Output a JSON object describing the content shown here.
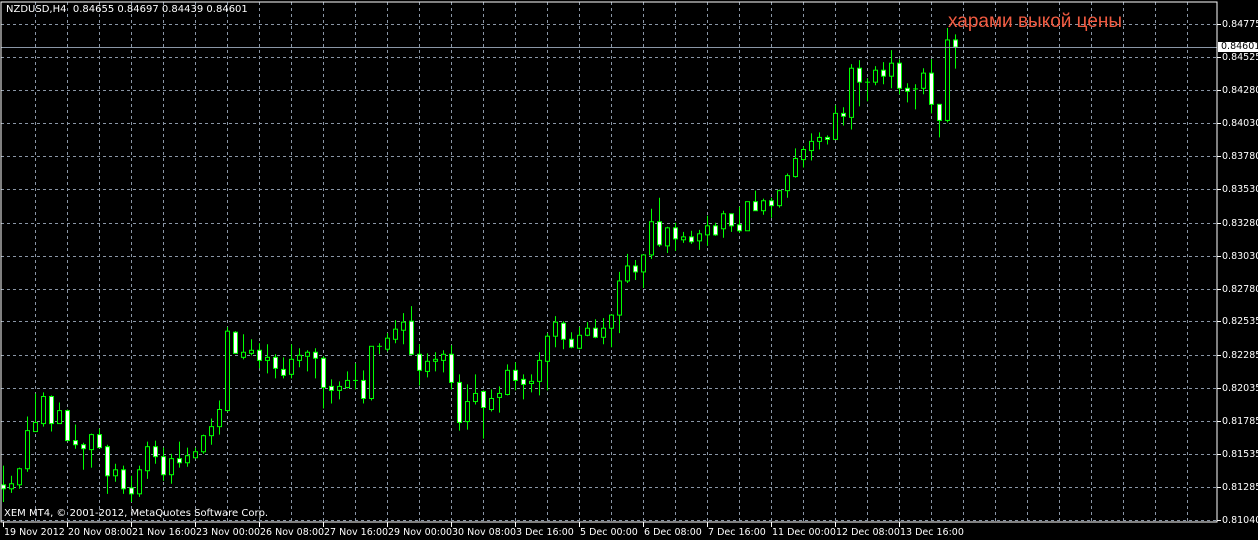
{
  "header": {
    "symbol": "NZDUSD,H4",
    "ohlc": "0.84655 0.84697 0.84439 0.84601"
  },
  "copyright": "XEM MT4, © 2001-2012, MetaQuotes Software Corp.",
  "annotation": "харами выкой цены",
  "current_price_label": "0.84601",
  "colors": {
    "background": "#000000",
    "candle_outline": "#00ff00",
    "bear_fill": "#ffffff",
    "bull_fill": "#000000",
    "grid": "#8a96a6",
    "annotation": "#f05a40"
  },
  "chart_data": {
    "type": "candlestick",
    "symbol": "NZDUSD",
    "timeframe": "H4",
    "ylim": [
      0.8104,
      0.84775
    ],
    "grid": true,
    "y_ticks": [
      "0.84775",
      "0.84525",
      "0.84280",
      "0.84030",
      "0.83780",
      "0.83530",
      "0.83280",
      "0.83030",
      "0.82780",
      "0.82535",
      "0.82285",
      "0.82035",
      "0.81785",
      "0.81535",
      "0.81285",
      "0.81040"
    ],
    "x_ticks": [
      "19 Nov 2012",
      "20 Nov 08:00",
      "21 Nov 16:00",
      "23 Nov 00:00",
      "26 Nov 08:00",
      "27 Nov 16:00",
      "29 Nov 00:00",
      "30 Nov 08:00",
      "3 Dec 16:00",
      "5 Dec 00:00",
      "6 Dec 08:00",
      "7 Dec 16:00",
      "11 Dec 00:00",
      "12 Dec 08:00",
      "13 Dec 16:00"
    ],
    "x_tick_every_n_bars": 8,
    "current_price": 0.84601,
    "ohlc": [
      [
        0.81305,
        0.81449,
        0.81176,
        0.81275
      ],
      [
        0.81275,
        0.81373,
        0.81244,
        0.81313
      ],
      [
        0.81305,
        0.81434,
        0.81275,
        0.81426
      ],
      [
        0.81426,
        0.81819,
        0.81403,
        0.81713
      ],
      [
        0.81706,
        0.81993,
        0.81706,
        0.81774
      ],
      [
        0.81766,
        0.82001,
        0.81743,
        0.8197
      ],
      [
        0.8197,
        0.81978,
        0.81706,
        0.81766
      ],
      [
        0.81766,
        0.81925,
        0.81766,
        0.81864
      ],
      [
        0.81864,
        0.81872,
        0.81638,
        0.81638
      ],
      [
        0.81638,
        0.81759,
        0.81577,
        0.81607
      ],
      [
        0.81607,
        0.81622,
        0.81418,
        0.81577
      ],
      [
        0.8157,
        0.8169,
        0.81434,
        0.81683
      ],
      [
        0.81683,
        0.81728,
        0.81585,
        0.81585
      ],
      [
        0.81592,
        0.81607,
        0.81237,
        0.81373
      ],
      [
        0.81373,
        0.81464,
        0.81328,
        0.81418
      ],
      [
        0.81418,
        0.81449,
        0.81237,
        0.81275
      ],
      [
        0.81282,
        0.81373,
        0.81176,
        0.81237
      ],
      [
        0.81237,
        0.81449,
        0.81214,
        0.81418
      ],
      [
        0.81411,
        0.8163,
        0.8135,
        0.81592
      ],
      [
        0.81592,
        0.81638,
        0.81464,
        0.81517
      ],
      [
        0.81517,
        0.81585,
        0.81335,
        0.81381
      ],
      [
        0.81381,
        0.81539,
        0.81313,
        0.81502
      ],
      [
        0.81502,
        0.8163,
        0.81434,
        0.81471
      ],
      [
        0.81471,
        0.81585,
        0.81441,
        0.81524
      ],
      [
        0.81509,
        0.81585,
        0.81502,
        0.81554
      ],
      [
        0.81554,
        0.81683,
        0.81539,
        0.81675
      ],
      [
        0.81675,
        0.81804,
        0.81607,
        0.81743
      ],
      [
        0.81743,
        0.8194,
        0.81683,
        0.81872
      ],
      [
        0.81864,
        0.82492,
        0.81857,
        0.82462
      ],
      [
        0.82454,
        0.82462,
        0.82295,
        0.82295
      ],
      [
        0.82265,
        0.82439,
        0.8225,
        0.82303
      ],
      [
        0.82295,
        0.82401,
        0.8228,
        0.82318
      ],
      [
        0.82318,
        0.82371,
        0.82182,
        0.82242
      ],
      [
        0.82242,
        0.82363,
        0.82144,
        0.82265
      ],
      [
        0.82265,
        0.82288,
        0.82106,
        0.82182
      ],
      [
        0.82174,
        0.82265,
        0.82106,
        0.82129
      ],
      [
        0.82137,
        0.82363,
        0.82106,
        0.8225
      ],
      [
        0.82242,
        0.82333,
        0.8219,
        0.8228
      ],
      [
        0.82273,
        0.82318,
        0.82159,
        0.82303
      ],
      [
        0.82303,
        0.82333,
        0.82106,
        0.82258
      ],
      [
        0.82258,
        0.82273,
        0.8188,
        0.82038
      ],
      [
        0.82046,
        0.82099,
        0.81917,
        0.82016
      ],
      [
        0.82016,
        0.82084,
        0.81948,
        0.82046
      ],
      [
        0.82038,
        0.82159,
        0.82031,
        0.82091
      ],
      [
        0.82091,
        0.8222,
        0.82023,
        0.82091
      ],
      [
        0.82091,
        0.82167,
        0.81917,
        0.81955
      ],
      [
        0.81955,
        0.82348,
        0.8194,
        0.82348
      ],
      [
        0.82341,
        0.82371,
        0.82288,
        0.82348
      ],
      [
        0.82326,
        0.82447,
        0.8231,
        0.82409
      ],
      [
        0.82401,
        0.82545,
        0.82371,
        0.82477
      ],
      [
        0.82469,
        0.82598,
        0.82363,
        0.8253
      ],
      [
        0.82537,
        0.82651,
        0.82288,
        0.82288
      ],
      [
        0.82288,
        0.82363,
        0.82053,
        0.82167
      ],
      [
        0.82159,
        0.82295,
        0.82114,
        0.82235
      ],
      [
        0.82235,
        0.82303,
        0.82159,
        0.8225
      ],
      [
        0.82242,
        0.82318,
        0.82152,
        0.82288
      ],
      [
        0.82288,
        0.82356,
        0.82023,
        0.82076
      ],
      [
        0.82076,
        0.82137,
        0.81713,
        0.81774
      ],
      [
        0.81781,
        0.82061,
        0.81721,
        0.81932
      ],
      [
        0.81932,
        0.82137,
        0.8191,
        0.81993
      ],
      [
        0.82008,
        0.82016,
        0.81653,
        0.81887
      ],
      [
        0.81872,
        0.82023,
        0.81857,
        0.81955
      ],
      [
        0.81963,
        0.82046,
        0.81849,
        0.81993
      ],
      [
        0.81985,
        0.82212,
        0.81978,
        0.82167
      ],
      [
        0.82167,
        0.82227,
        0.82016,
        0.82091
      ],
      [
        0.82099,
        0.82137,
        0.81948,
        0.82061
      ],
      [
        0.82068,
        0.82137,
        0.82001,
        0.82084
      ],
      [
        0.82084,
        0.82303,
        0.81978,
        0.82242
      ],
      [
        0.82235,
        0.82447,
        0.82016,
        0.82424
      ],
      [
        0.82424,
        0.82575,
        0.82341,
        0.8253
      ],
      [
        0.82522,
        0.82537,
        0.82326,
        0.82401
      ],
      [
        0.82401,
        0.82454,
        0.82333,
        0.82341
      ],
      [
        0.82333,
        0.82492,
        0.82326,
        0.82431
      ],
      [
        0.82431,
        0.8253,
        0.82424,
        0.82484
      ],
      [
        0.82484,
        0.82552,
        0.82409,
        0.82416
      ],
      [
        0.82416,
        0.8256,
        0.82363,
        0.82484
      ],
      [
        0.82484,
        0.8259,
        0.82341,
        0.82583
      ],
      [
        0.82583,
        0.82908,
        0.82447,
        0.8284
      ],
      [
        0.8284,
        0.83044,
        0.82825,
        0.82953
      ],
      [
        0.82953,
        0.82998,
        0.82847,
        0.82908
      ],
      [
        0.82908,
        0.83036,
        0.82787,
        0.83036
      ],
      [
        0.83036,
        0.83384,
        0.83006,
        0.83286
      ],
      [
        0.83286,
        0.83467,
        0.83097,
        0.83112
      ],
      [
        0.83104,
        0.83248,
        0.83051,
        0.8324
      ],
      [
        0.8324,
        0.83278,
        0.83066,
        0.83157
      ],
      [
        0.8315,
        0.8321,
        0.83127,
        0.83172
      ],
      [
        0.83172,
        0.83218,
        0.83119,
        0.83135
      ],
      [
        0.83142,
        0.83225,
        0.83074,
        0.83195
      ],
      [
        0.83187,
        0.83331,
        0.83104,
        0.83255
      ],
      [
        0.83255,
        0.83278,
        0.8318,
        0.83187
      ],
      [
        0.83233,
        0.83369,
        0.83165,
        0.83346
      ],
      [
        0.83346,
        0.83346,
        0.8321,
        0.83255
      ],
      [
        0.83263,
        0.83399,
        0.83203,
        0.83218
      ],
      [
        0.83218,
        0.83437,
        0.83218,
        0.83437
      ],
      [
        0.83437,
        0.8352,
        0.83369,
        0.83369
      ],
      [
        0.83369,
        0.8346,
        0.83339,
        0.83444
      ],
      [
        0.83444,
        0.83467,
        0.83316,
        0.83407
      ],
      [
        0.83407,
        0.83528,
        0.83392,
        0.8352
      ],
      [
        0.8352,
        0.83649,
        0.83467,
        0.83633
      ],
      [
        0.83626,
        0.83838,
        0.83618,
        0.83762
      ],
      [
        0.83754,
        0.83853,
        0.83694,
        0.8383
      ],
      [
        0.83822,
        0.83951,
        0.83747,
        0.83891
      ],
      [
        0.83891,
        0.83959,
        0.8383,
        0.83921
      ],
      [
        0.83921,
        0.83936,
        0.83868,
        0.83906
      ],
      [
        0.83906,
        0.84163,
        0.83906,
        0.84102
      ],
      [
        0.84102,
        0.84148,
        0.84011,
        0.8408
      ],
      [
        0.84072,
        0.84473,
        0.83981,
        0.84442
      ],
      [
        0.84442,
        0.84503,
        0.84155,
        0.84337
      ],
      [
        0.84337,
        0.84367,
        0.84193,
        0.84337
      ],
      [
        0.84337,
        0.84458,
        0.84314,
        0.84427
      ],
      [
        0.84427,
        0.84488,
        0.84321,
        0.84382
      ],
      [
        0.84382,
        0.84578,
        0.84291,
        0.8448
      ],
      [
        0.8448,
        0.8451,
        0.84246,
        0.84291
      ],
      [
        0.84291,
        0.84329,
        0.84185,
        0.84268
      ],
      [
        0.84284,
        0.84321,
        0.84132,
        0.84286
      ],
      [
        0.84291,
        0.84442,
        0.84246,
        0.84405
      ],
      [
        0.84405,
        0.8451,
        0.84102,
        0.8417
      ],
      [
        0.8417,
        0.8417,
        0.83921,
        0.84049
      ],
      [
        0.84049,
        0.84745,
        0.84034,
        0.84655
      ],
      [
        0.84655,
        0.84697,
        0.84439,
        0.84601
      ]
    ]
  }
}
